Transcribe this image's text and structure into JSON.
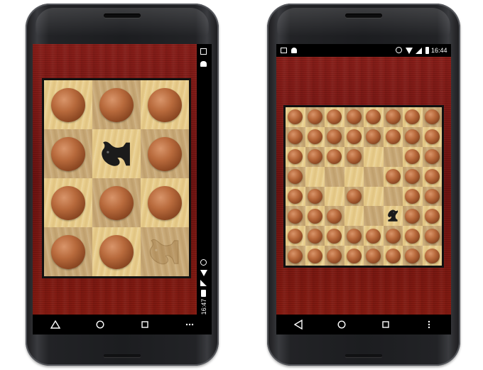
{
  "phone_left": {
    "status_bar": {
      "time": "16:47",
      "orientation": "landscape"
    },
    "board": {
      "rows": 4,
      "cols": 3,
      "pieces": [
        [
          "ball",
          "ball",
          "ball"
        ],
        [
          "ball",
          "knight",
          "ball"
        ],
        [
          "ball",
          "ball",
          "ball"
        ],
        [
          "ball",
          "ball",
          "ghost-knight"
        ]
      ]
    },
    "nav": [
      "back",
      "home",
      "recents",
      "more"
    ]
  },
  "phone_right": {
    "status_bar": {
      "time": "16:44"
    },
    "board": {
      "rows": 8,
      "cols": 8,
      "pieces": [
        [
          "ball",
          "ball",
          "ball",
          "ball",
          "ball",
          "ball",
          "ball",
          "ball"
        ],
        [
          "ball",
          "ball",
          "ball",
          "ball",
          "ball",
          "ball",
          "ball",
          "ball"
        ],
        [
          "ball",
          "ball",
          "ball",
          "ball",
          "",
          "",
          "ball",
          "ball"
        ],
        [
          "ball",
          "",
          "",
          "",
          "",
          "ball",
          "ball",
          "ball"
        ],
        [
          "ball",
          "ball",
          "",
          "ball",
          "",
          "",
          "ball",
          "ball"
        ],
        [
          "ball",
          "ball",
          "ball",
          "",
          "",
          "knight",
          "ball",
          "ball"
        ],
        [
          "ball",
          "ball",
          "ball",
          "ball",
          "ball",
          "ball",
          "ball",
          "ball"
        ],
        [
          "ball",
          "ball",
          "ball",
          "ball",
          "ball",
          "ball",
          "ball",
          "ball"
        ]
      ]
    },
    "nav": [
      "back",
      "home",
      "recents",
      "more"
    ]
  },
  "colors": {
    "wood_red": "#7a1512",
    "square_light": "#e8cd8c",
    "square_dark": "#c9aa78",
    "ball": "#b86a3c",
    "knight": "#1b1b1b"
  }
}
